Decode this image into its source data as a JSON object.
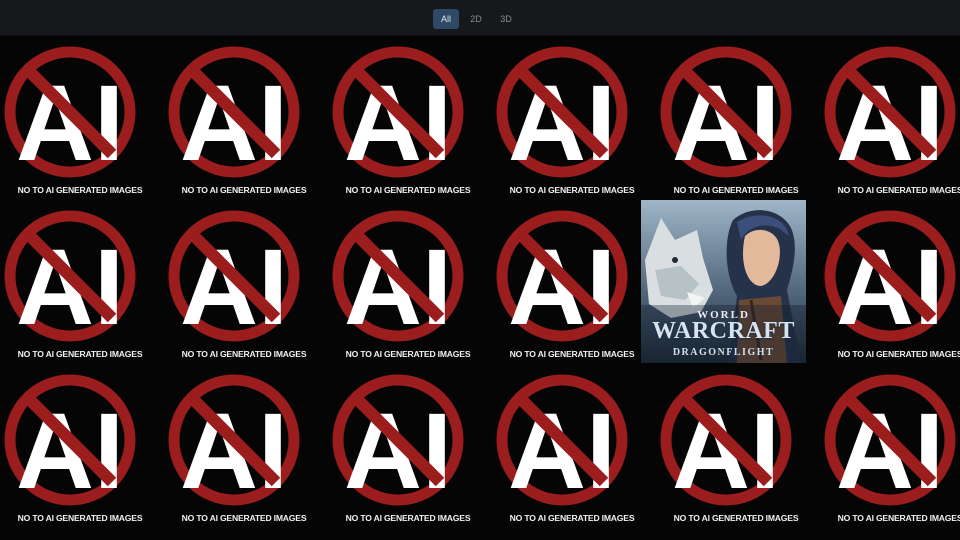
{
  "filter": {
    "tabs": [
      {
        "label": "All",
        "active": true
      },
      {
        "label": "2D",
        "active": false
      },
      {
        "label": "3D",
        "active": false
      }
    ]
  },
  "gallery": {
    "no_ai_caption": "NO TO AI GENERATED IMAGES",
    "no_ai_sign_letters": "AI",
    "featured": {
      "line1": "WORLD",
      "line2": "WARCRAFT",
      "line3": "DRAGONFLIGHT"
    }
  },
  "colors": {
    "topbar": "#16181b",
    "active_tab": "#2f4a66",
    "sign_red": "#9b1d1d",
    "background": "#050505"
  }
}
